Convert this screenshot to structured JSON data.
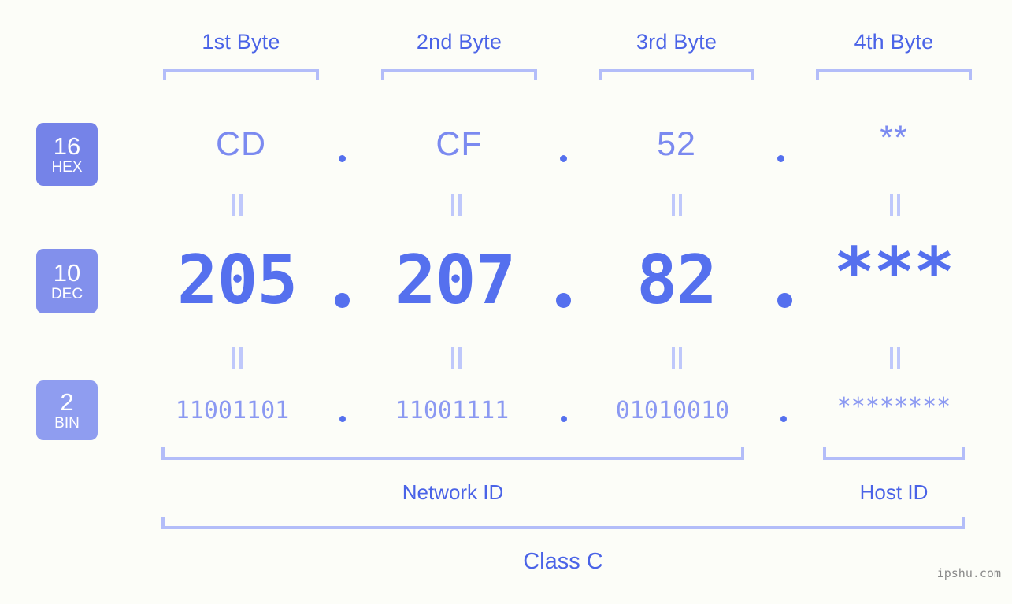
{
  "background_color": "#fcfdf8",
  "accent_color": "#5570ee",
  "bracket_color": "#b3bdf9",
  "byte_headers": [
    {
      "label": "1st Byte"
    },
    {
      "label": "2nd Byte"
    },
    {
      "label": "3rd Byte"
    },
    {
      "label": "4th Byte"
    }
  ],
  "rows": [
    {
      "badge": {
        "number": "16",
        "name": "HEX",
        "color": "#7583e8"
      },
      "values": [
        "CD",
        "CF",
        "52",
        "**"
      ],
      "separator": "."
    },
    {
      "badge": {
        "number": "10",
        "name": "DEC",
        "color": "#8290ec"
      },
      "values": [
        "205",
        "207",
        "82",
        "***"
      ],
      "separator": "."
    },
    {
      "badge": {
        "number": "2",
        "name": "BIN",
        "color": "#8f9df0"
      },
      "values": [
        "11001101",
        "11001111",
        "01010010",
        "********"
      ],
      "separator": "."
    }
  ],
  "equal_marks": {
    "glyph": "=",
    "count_per_row": 4
  },
  "sections": [
    {
      "label": "Network ID"
    },
    {
      "label": "Host ID"
    }
  ],
  "class_label": "Class C",
  "watermark": "ipshu.com"
}
